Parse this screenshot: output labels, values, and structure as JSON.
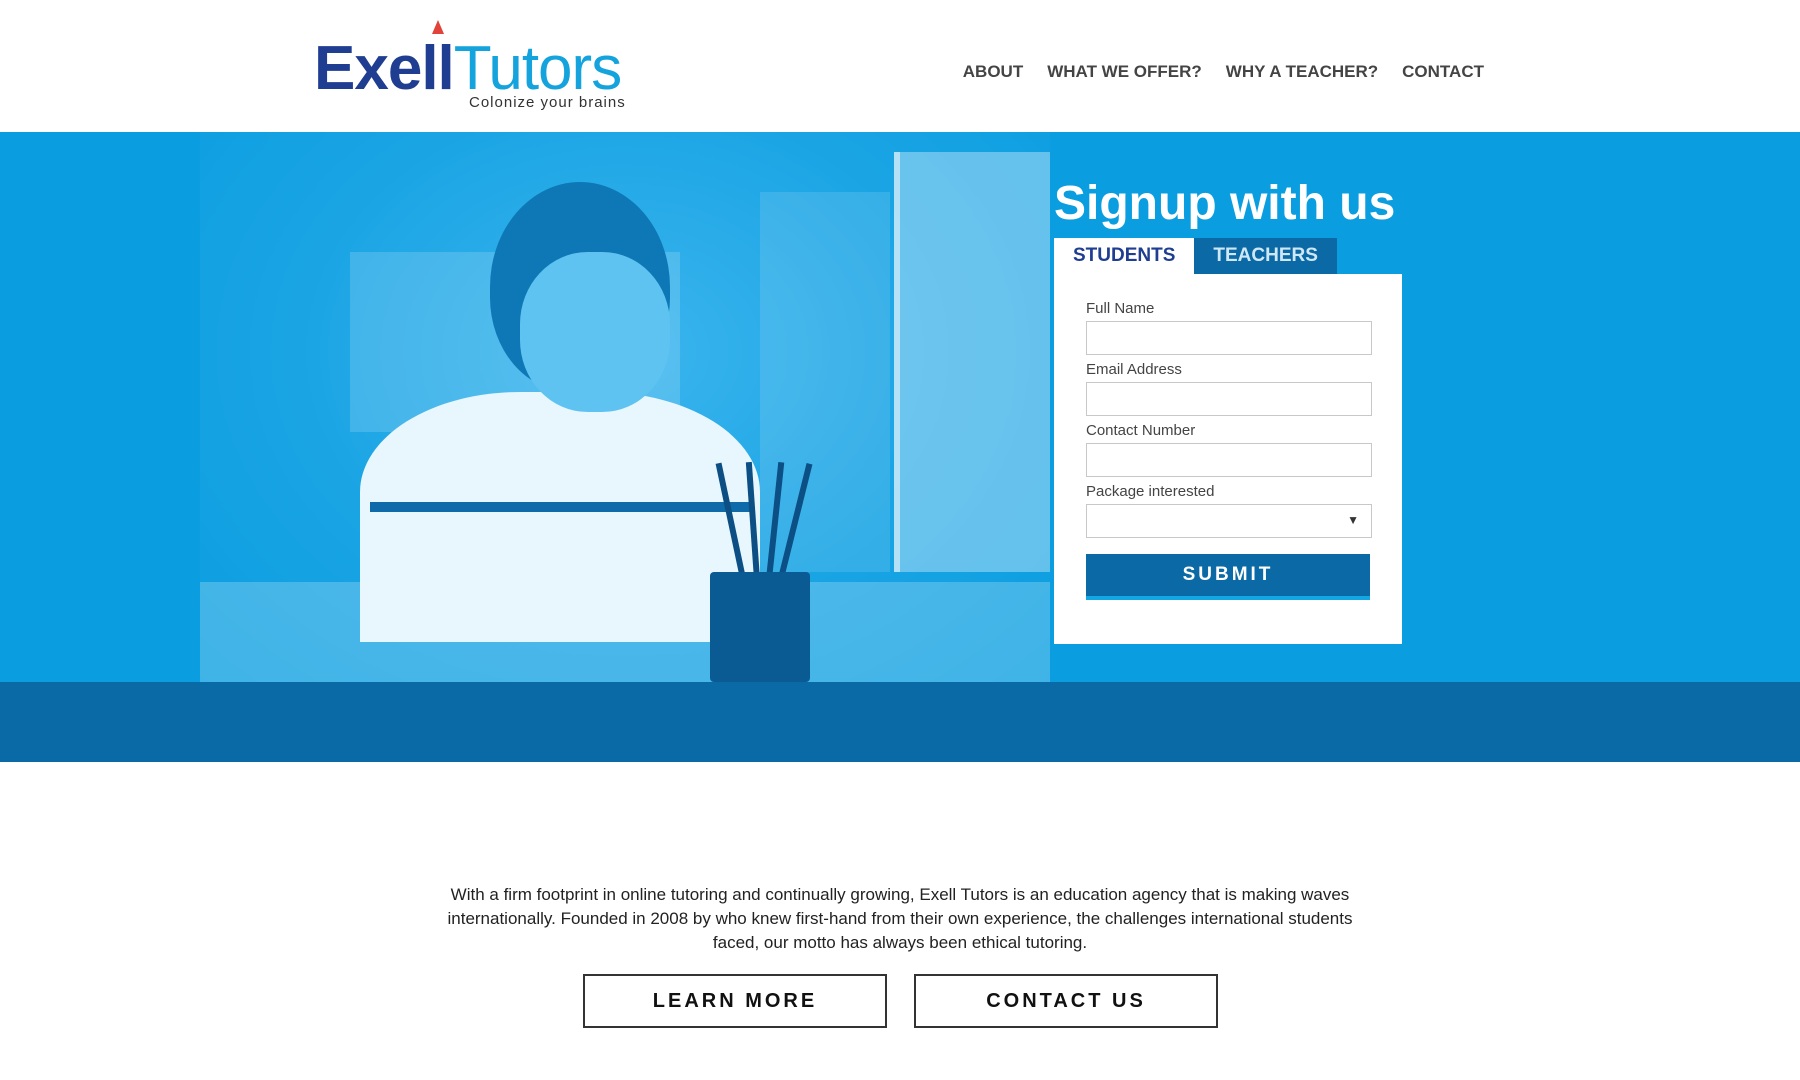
{
  "brand": {
    "name_part1": "Exell",
    "name_part2": "Tutors",
    "tagline": "Colonize your brains",
    "colors": {
      "dark_blue": "#1f3d91",
      "light_blue": "#14a3dc",
      "hero_blue": "#0a9ee0",
      "band_blue": "#0a6aa6",
      "pencil_red": "#e0433a"
    }
  },
  "nav": {
    "items": [
      {
        "label": "ABOUT"
      },
      {
        "label": "WHAT WE OFFER?"
      },
      {
        "label": "WHY A TEACHER?"
      },
      {
        "label": "CONTACT"
      }
    ]
  },
  "signup": {
    "title": "Signup with us",
    "tabs": [
      {
        "label": "STUDENTS",
        "active": true
      },
      {
        "label": "TEACHERS",
        "active": false
      }
    ],
    "fields": {
      "full_name": {
        "label": "Full Name",
        "value": ""
      },
      "email": {
        "label": "Email Address",
        "value": ""
      },
      "contact": {
        "label": "Contact Number",
        "value": ""
      },
      "package": {
        "label": "Package interested",
        "value": "",
        "icon": "dropdown-arrow-icon"
      }
    },
    "submit_label": "SUBMIT"
  },
  "about": {
    "text": "With a firm footprint in online tutoring and continually growing, Exell Tutors is an education agency that is making waves internationally. Founded in 2008 by who knew first-hand from their own experience, the challenges international students faced, our motto has always been ethical tutoring.",
    "learn_more_label": "LEARN MORE",
    "contact_us_label": "CONTACT US"
  }
}
